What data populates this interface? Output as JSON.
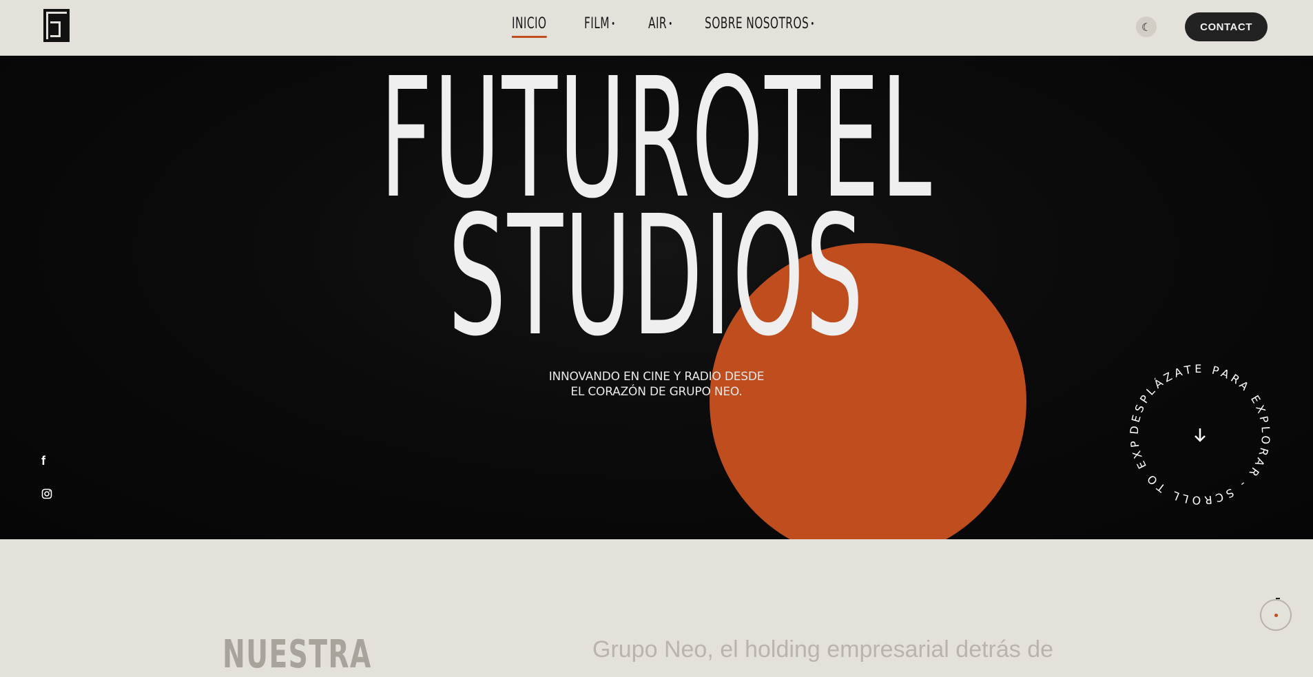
{
  "colors": {
    "accent": "#c04d1e",
    "background": "#e4e1da",
    "hero_bg": "#0a0a0a"
  },
  "header": {
    "nav": [
      {
        "label": "INICIO",
        "active": true,
        "has_dot": false
      },
      {
        "label": "FILM",
        "active": false,
        "has_dot": true
      },
      {
        "label": "AIR",
        "active": false,
        "has_dot": true
      },
      {
        "label": "SOBRE NOSOTROS",
        "active": false,
        "has_dot": true
      }
    ],
    "dot": "•",
    "theme_icon": "☾",
    "contact_label": "CONTACT"
  },
  "hero": {
    "title_line1": "FUTUROTEL",
    "title_line2": "STUDIOS",
    "subtitle_line1": "INNOVANDO EN CINE Y RADIO DESDE",
    "subtitle_line2": "EL CORAZÓN DE GRUPO NEO.",
    "scroll_text": "DESPLÁZATE PARA EXPLORAR - SCROLL TO EXPLORE - ",
    "social": {
      "facebook": "f",
      "instagram": "◎"
    }
  },
  "section": {
    "heading": "NUESTRA",
    "intro": "Grupo Neo, el holding empresarial detrás de"
  }
}
